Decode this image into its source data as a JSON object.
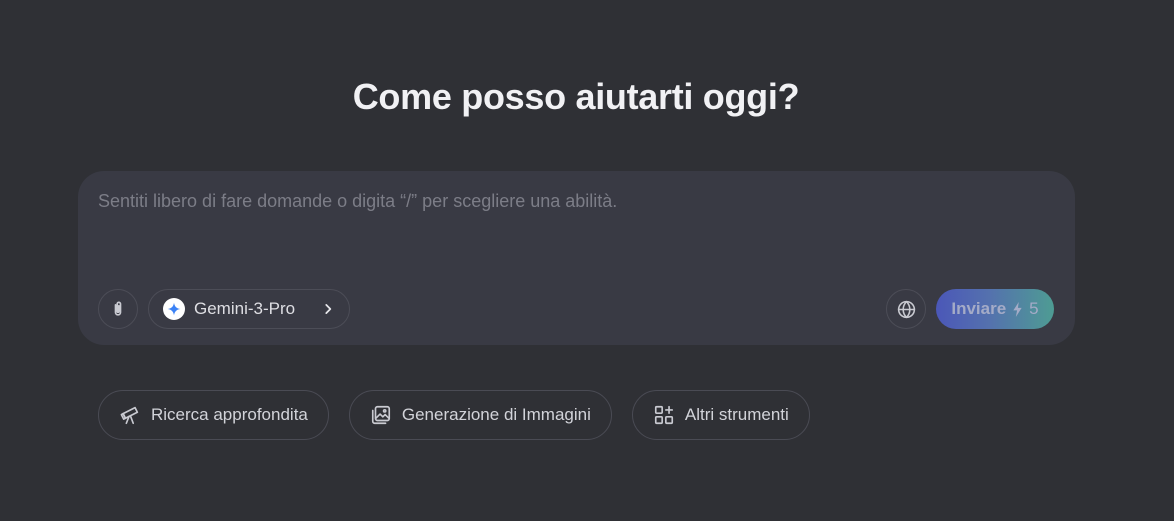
{
  "header": {
    "title": "Come posso aiutarti oggi?"
  },
  "composer": {
    "placeholder": "Sentiti libero di fare domande o digita “/” per scegliere una abilità.",
    "value": "",
    "attach_icon": "paperclip-icon",
    "model": {
      "label": "Gemini-3-Pro",
      "icon": "gemini-sparkle-icon",
      "chevron_icon": "chevron-right-icon"
    },
    "web_search_icon": "globe-icon",
    "send": {
      "label": "Inviare",
      "credits": "5",
      "credits_icon": "lightning-bolt-icon"
    }
  },
  "quick_actions": [
    {
      "label": "Ricerca approfondita",
      "icon": "telescope-icon"
    },
    {
      "label": "Generazione di Immagini",
      "icon": "image-icon"
    },
    {
      "label": "Altri strumenti",
      "icon": "grid-plus-icon"
    }
  ],
  "colors": {
    "background": "#2f3035",
    "composer_background": "#393a44",
    "border": "#4c4d57",
    "send_gradient_start": "#4b57b8",
    "send_gradient_end": "#4e9c93",
    "placeholder": "#7c7d87",
    "gemini_accent": "#3b82f6"
  }
}
